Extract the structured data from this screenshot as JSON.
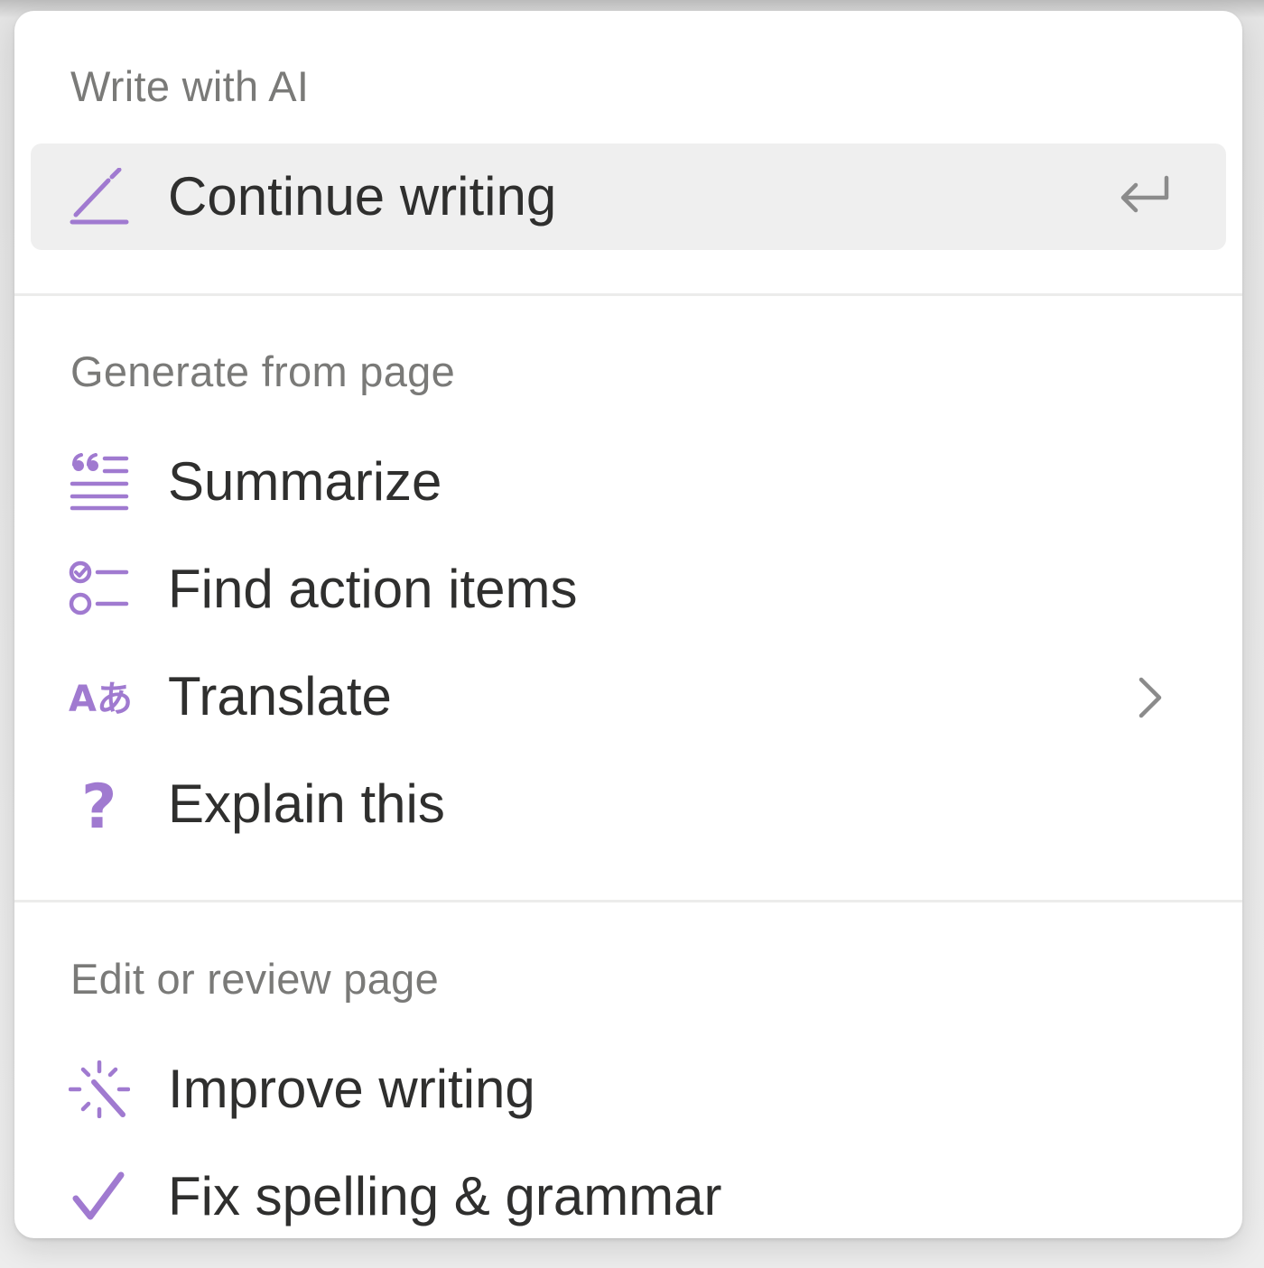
{
  "colors": {
    "accent": "#a07ad0",
    "text": "#2f2f2e",
    "header": "#7a7a78",
    "selected_bg": "#efefef"
  },
  "sections": {
    "write": {
      "header": "Write with AI",
      "items": [
        {
          "label": "Continue writing",
          "icon": "pencil-icon",
          "trailing": "enter-icon",
          "selected": true
        }
      ]
    },
    "generate": {
      "header": "Generate from page",
      "items": [
        {
          "label": "Summarize",
          "icon": "quote-lines-icon"
        },
        {
          "label": "Find action items",
          "icon": "checklist-icon"
        },
        {
          "label": "Translate",
          "icon": "translate-icon",
          "icon_text": "Aあ",
          "trailing": "chevron-right-icon"
        },
        {
          "label": "Explain this",
          "icon": "question-icon",
          "icon_text": "?"
        }
      ]
    },
    "edit": {
      "header": "Edit or review page",
      "items": [
        {
          "label": "Improve writing",
          "icon": "magic-wand-icon"
        },
        {
          "label": "Fix spelling & grammar",
          "icon": "checkmark-icon"
        }
      ]
    }
  }
}
